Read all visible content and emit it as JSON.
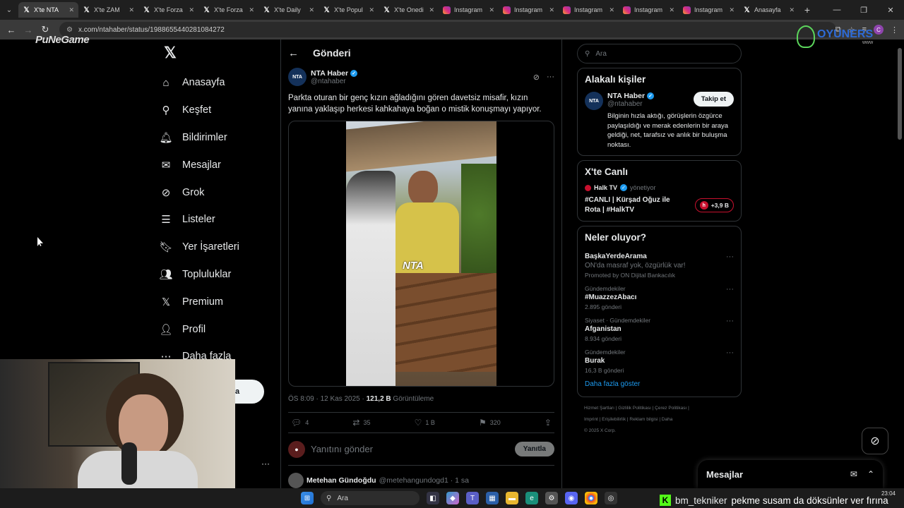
{
  "browser": {
    "tabs": [
      {
        "title": "X'te NTA",
        "icon": "x-logo-icon",
        "active": true
      },
      {
        "title": "X'te ZAM",
        "icon": "x-logo-icon"
      },
      {
        "title": "X'te Forza",
        "icon": "x-logo-icon"
      },
      {
        "title": "X'te Forza",
        "icon": "x-logo-icon"
      },
      {
        "title": "X'te Daily",
        "icon": "x-logo-icon"
      },
      {
        "title": "X'te Popul",
        "icon": "x-logo-icon"
      },
      {
        "title": "X'te Onedi",
        "icon": "x-logo-icon"
      },
      {
        "title": "Instagram",
        "icon": "instagram-icon"
      },
      {
        "title": "Instagram",
        "icon": "instagram-icon"
      },
      {
        "title": "Instagram",
        "icon": "instagram-icon"
      },
      {
        "title": "Instagram",
        "icon": "instagram-icon"
      },
      {
        "title": "Instagram",
        "icon": "instagram-icon"
      },
      {
        "title": "Anasayfa",
        "icon": "x-logo-icon"
      }
    ],
    "url": "x.com/ntahaber/status/1988655440281084272",
    "profile_initial": "C"
  },
  "watermarks": {
    "left": "PuNeGame",
    "right": "OYUNERS",
    "right_sub": "www"
  },
  "nav": {
    "items": [
      {
        "label": "Anasayfa",
        "icon": "home-icon",
        "glyph": "⌂"
      },
      {
        "label": "Keşfet",
        "icon": "search-icon",
        "glyph": "⚲"
      },
      {
        "label": "Bildirimler",
        "icon": "bell-icon",
        "glyph": "🔔︎"
      },
      {
        "label": "Mesajlar",
        "icon": "envelope-icon",
        "glyph": "✉"
      },
      {
        "label": "Grok",
        "icon": "grok-icon",
        "glyph": "⊘"
      },
      {
        "label": "Listeler",
        "icon": "list-icon",
        "glyph": "☰"
      },
      {
        "label": "Yer İşaretleri",
        "icon": "bookmark-icon",
        "glyph": "🔖︎"
      },
      {
        "label": "Topluluklar",
        "icon": "communities-icon",
        "glyph": "👥︎"
      },
      {
        "label": "Premium",
        "icon": "x-premium-icon",
        "glyph": "𝕏"
      },
      {
        "label": "Profil",
        "icon": "profile-icon",
        "glyph": "👤︎"
      },
      {
        "label": "Daha fazla",
        "icon": "more-icon",
        "glyph": "⋯"
      }
    ],
    "post_button_partial": "a",
    "account_more": "···"
  },
  "main": {
    "header_title": "Gönderi",
    "tweet": {
      "author_name": "NTA Haber",
      "author_handle": "@ntahaber",
      "avatar_text": "NTA",
      "text": "Parkta oturan bir genç kızın ağladığını gören davetsiz misafir, kızın yanına yaklaşıp herkesi kahkahaya boğan o mistik konuşmayı yapıyor.",
      "video_logo": "NTA",
      "time": "ÖS 8:09 · 12 Kas 2025 · ",
      "views": "121,2 B",
      "views_label": " Görüntüleme",
      "replies": "4",
      "reposts": "35",
      "likes": "1 B",
      "bookmarks": "320"
    },
    "reply_placeholder": "Yanıtını gönder",
    "reply_button": "Yanıtla",
    "next_reply_author": "Metehan Gündoğdu",
    "next_reply_handle": "@metehangundogd1 · 1 sa"
  },
  "right": {
    "search_placeholder": "Ara",
    "related": {
      "title": "Alakalı kişiler",
      "name": "NTA Haber",
      "handle": "@ntahaber",
      "follow": "Takip et",
      "bio": "Bilginin hızla aktığı, görüşlerin özgürce paylaşıldığı ve merak edenlerin bir araya geldiği, net, tarafsız ve anlık bir buluşma noktası."
    },
    "live": {
      "title": "X'te Canlı",
      "host": "Halk TV",
      "role": "yönetiyor",
      "stream_title": "#CANLI | Kürşad Oğuz ile Rota | #HalkTV",
      "listeners": "+3,9 B"
    },
    "trends": {
      "title": "Neler oluyor?",
      "items": [
        {
          "category": "",
          "name": "BaşkaYerdeArama",
          "sub": "ON'da masraf yok, özgürlük var!",
          "count": "Promoted by ON Dijital Bankacılık"
        },
        {
          "category": "Gündemdekiler",
          "name": "#MuazzezAbacı",
          "sub": "",
          "count": "2.895 gönderi"
        },
        {
          "category": "Siyaset · Gündemdekiler",
          "name": "Afganistan",
          "sub": "",
          "count": "8.934 gönderi"
        },
        {
          "category": "Gündemdekiler",
          "name": "Burak",
          "sub": "",
          "count": "16,3 B gönderi"
        }
      ],
      "show_more": "Daha fazla göster"
    },
    "footer": {
      "line1": "Hizmet Şartları  |  Gizlilik Politikası  |  Çerez Politikası  |",
      "line2": "Imprint  |  Erişilebilirlik  |  Reklam bilgisi  |  Daha",
      "line3": "© 2025 X Corp."
    }
  },
  "messages_drawer": {
    "title": "Mesajlar"
  },
  "taskbar": {
    "search": "Ara",
    "time": "23:04",
    "date": ""
  },
  "ticker": {
    "user": "bm_tekniker",
    "message": "pekme susam da döksünler ver fırına"
  },
  "colors": {
    "accent": "#1d9bf0",
    "live": "#c8102e",
    "kick": "#53fc18"
  }
}
